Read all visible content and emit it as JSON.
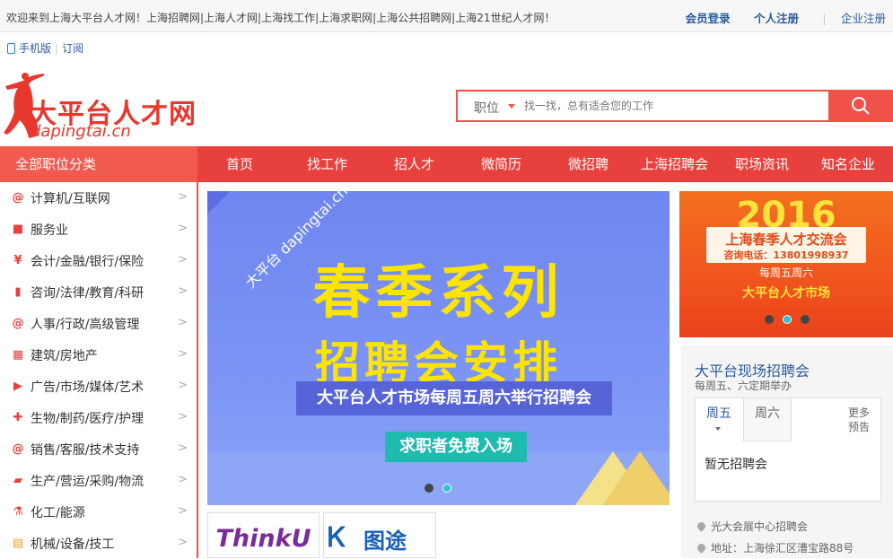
{
  "topbar": {
    "welcome": "欢迎来到上海大平台人才网！上海招聘网|上海人才网|上海找工作|上海求职网|上海公共招聘网|上海21世纪人才网！",
    "login": "会员登录",
    "register": "个人注册",
    "enterprise": "企业注册"
  },
  "mobile": {
    "label": "手机版",
    "subscribe": "订阅"
  },
  "logo": {
    "cn": "大平台人才网",
    "en": "dapingtai.cn"
  },
  "search": {
    "category": "职位",
    "placeholder": "找一找，总有适合您的工作"
  },
  "nav": {
    "all_categories": "全部职位分类",
    "items": [
      "首页",
      "找工作",
      "招人才",
      "微简历",
      "微招聘",
      "上海招聘会",
      "职场资讯",
      "知名企业"
    ]
  },
  "categories": [
    {
      "label": "计算机/互联网",
      "icon": "at-icon"
    },
    {
      "label": "服务业",
      "icon": "bag-icon"
    },
    {
      "label": "会计/金融/银行/保险",
      "icon": "yen-icon"
    },
    {
      "label": "咨询/法律/教育/科研",
      "icon": "book-icon"
    },
    {
      "label": "人事/行政/高级管理",
      "icon": "at-icon"
    },
    {
      "label": "建筑/房地产",
      "icon": "building-icon"
    },
    {
      "label": "广告/市场/媒体/艺术",
      "icon": "video-icon"
    },
    {
      "label": "生物/制药/医疗/护理",
      "icon": "medkit-icon"
    },
    {
      "label": "销售/客服/技术支持",
      "icon": "at-icon"
    },
    {
      "label": "生产/营运/采购/物流",
      "icon": "truck-icon"
    },
    {
      "label": "化工/能源",
      "icon": "flask-icon"
    },
    {
      "label": "机械/设备/技工",
      "icon": "doc-icon"
    }
  ],
  "banner": {
    "corner_cn": "大平台",
    "corner_en": "dapingtai.cn",
    "title1": "春季系列",
    "title2": "招聘会安排",
    "subtitle": "大平台人才市场每周五周六举行招聘会",
    "badge": "求职者免费入场"
  },
  "partners": [
    {
      "name": "ThinkU"
    },
    {
      "name": "图途"
    }
  ],
  "ad": {
    "year": "2016",
    "title": "上海春季人才交流会",
    "phone": "咨询电话：13801998937",
    "schedule": "每周五周六",
    "brand": "大平台人才市场"
  },
  "fair": {
    "title": "大平台现场招聘会",
    "time": "每周五、六定期举办",
    "tabs": [
      "周五",
      "周六"
    ],
    "more": "更多",
    "preview": "预告",
    "empty": "暂无招聘会",
    "location": "光大会展中心招聘会",
    "address": "地址：上海徐汇区漕宝路88号"
  }
}
